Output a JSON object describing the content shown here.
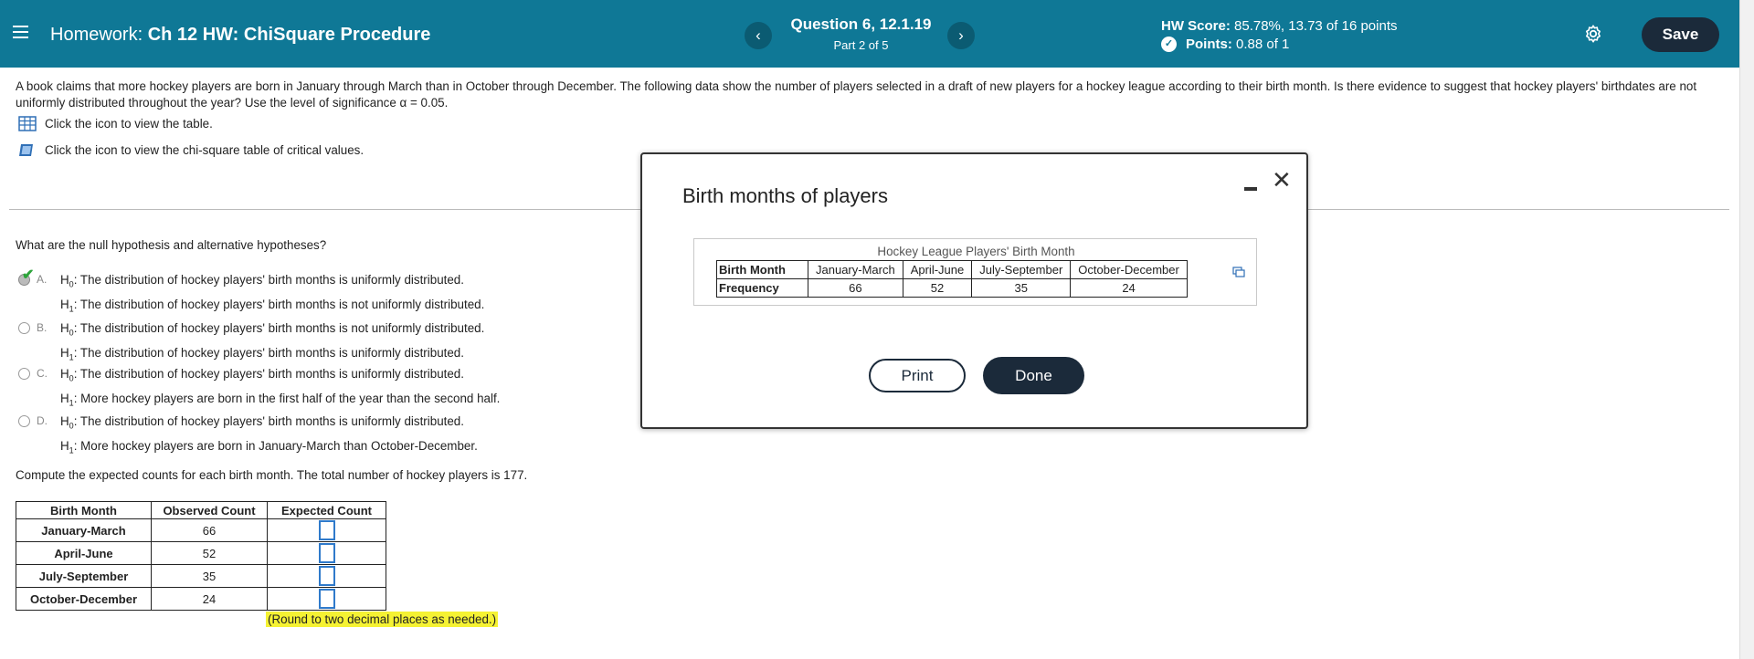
{
  "header": {
    "title_prefix": "Homework:",
    "title": "Ch 12 HW: ChiSquare Procedure",
    "question": "Question 6, 12.1.19",
    "part": "Part 2 of 5",
    "score_label": "HW Score:",
    "score_value": "85.78%, 13.73 of 16 points",
    "points_label": "Points:",
    "points_value": "0.88 of 1",
    "save_label": "Save",
    "prev_glyph": "‹",
    "next_glyph": "›",
    "brand_color": "#0f7896"
  },
  "question": {
    "intro": "A book claims that more hockey players are born in January through March than in October through December. The following data show the number of players selected in a draft of new players for a hockey league according to their birth month. Is there evidence to suggest that hockey players' birthdates are not uniformly distributed throughout the year? Use the level of significance α = 0.05.",
    "link_table": "Click the icon to view the table.",
    "link_chi": "Click the icon to view the chi-square table of critical values.",
    "prompt": "What are the null hypothesis and alternative hypotheses?",
    "choices": [
      {
        "letter": "A.",
        "h0": "The distribution of hockey players' birth months is uniformly distributed.",
        "h1": "The distribution of hockey players' birth months is not uniformly distributed.",
        "selected": true
      },
      {
        "letter": "B.",
        "h0": "The distribution of hockey players' birth months is not uniformly distributed.",
        "h1": "The distribution of hockey players' birth months is uniformly distributed."
      },
      {
        "letter": "C.",
        "h0": "The distribution of hockey players' birth months is uniformly distributed.",
        "h1": "More hockey players are born in the first half of the year than the second half."
      },
      {
        "letter": "D.",
        "h0": "The distribution of hockey players' birth months is uniformly distributed.",
        "h1": "More hockey players are born in January-March than October-December."
      }
    ],
    "h0_label": "H",
    "h0_sub": "0",
    "h1_label": "H",
    "h1_sub": "1",
    "compute": "Compute the expected counts for each birth month. The total number of hockey players is 177.",
    "table": {
      "headers": [
        "Birth Month",
        "Observed Count",
        "Expected Count"
      ],
      "rows": [
        {
          "month": "January-March",
          "observed": "66"
        },
        {
          "month": "April-June",
          "observed": "52"
        },
        {
          "month": "July-September",
          "observed": "35"
        },
        {
          "month": "October-December",
          "observed": "24"
        }
      ]
    },
    "hint": "(Round to two decimal places as needed.)"
  },
  "modal": {
    "title": "Birth months of players",
    "caption": "Hockey League Players' Birth Month",
    "row1_label": "Birth Month",
    "row2_label": "Frequency",
    "months": [
      "January-March",
      "April-June",
      "July-September",
      "October-December"
    ],
    "frequencies": [
      "66",
      "52",
      "35",
      "24"
    ],
    "print_label": "Print",
    "done_label": "Done"
  }
}
